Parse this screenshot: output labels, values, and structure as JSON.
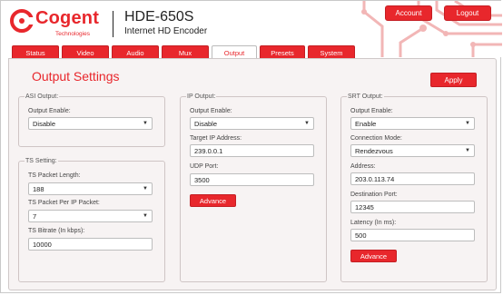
{
  "brand": {
    "name": "Cogent",
    "sub": "Technologies"
  },
  "header": {
    "model": "HDE-650S",
    "product": "Internet HD Encoder",
    "account": "Account",
    "logout": "Logout"
  },
  "tabs": [
    {
      "label": "Status"
    },
    {
      "label": "Video"
    },
    {
      "label": "Audio"
    },
    {
      "label": "Mux"
    },
    {
      "label": "Output"
    },
    {
      "label": "Presets"
    },
    {
      "label": "System"
    }
  ],
  "panel": {
    "title": "Output Settings",
    "apply": "Apply"
  },
  "asi": {
    "legend": "ASI Output:",
    "enable_label": "Output Enable:",
    "enable_value": "Disable"
  },
  "ts": {
    "legend": "TS Setting:",
    "packet_length_label": "TS Packet Length:",
    "packet_length_value": "188",
    "packet_per_ip_label": "TS Packet Per IP Packet:",
    "packet_per_ip_value": "7",
    "bitrate_label": "TS Bitrate (In kbps):",
    "bitrate_value": "10000"
  },
  "ip": {
    "legend": "IP Output:",
    "enable_label": "Output Enable:",
    "enable_value": "Disable",
    "target_label": "Target IP Address:",
    "target_value": "239.0.0.1",
    "port_label": "UDP Port:",
    "port_value": "3500",
    "advance": "Advance"
  },
  "srt": {
    "legend": "SRT Output:",
    "enable_label": "Output Enable:",
    "enable_value": "Enable",
    "mode_label": "Connection Mode:",
    "mode_value": "Rendezvous",
    "address_label": "Address:",
    "address_value": "203.0.113.74",
    "dest_port_label": "Destination Port:",
    "dest_port_value": "12345",
    "latency_label": "Latency (In ms):",
    "latency_value": "500",
    "advance": "Advance"
  },
  "colors": {
    "accent": "#e8272c",
    "panel_bg": "#f7f3f3"
  },
  "active_tab": "Output"
}
